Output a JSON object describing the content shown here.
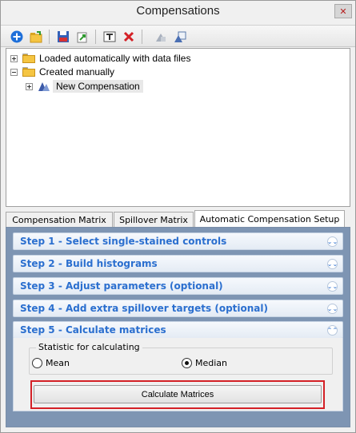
{
  "window": {
    "title": "Compensations",
    "close_glyph": "✕"
  },
  "toolbar": {
    "buttons": [
      {
        "icon": "add-icon"
      },
      {
        "icon": "open-folder-icon"
      },
      {
        "icon": "save-icon"
      },
      {
        "icon": "export-icon"
      },
      {
        "icon": "rename-icon"
      },
      {
        "icon": "delete-icon"
      },
      {
        "icon": "copy-icon"
      },
      {
        "icon": "duplicate-icon"
      }
    ]
  },
  "tree": {
    "items": [
      {
        "label": "Loaded automatically with data files",
        "expander": "+"
      },
      {
        "label": "Created manually",
        "expander": "−"
      },
      {
        "label": "New Compensation",
        "expander": "+"
      }
    ]
  },
  "tabs": [
    {
      "label": "Compensation Matrix"
    },
    {
      "label": "Spillover Matrix"
    },
    {
      "label": "Automatic Compensation Setup"
    }
  ],
  "steps": [
    {
      "label": "Step 1 - Select single-stained controls",
      "chevron": "⌄⌄"
    },
    {
      "label": "Step 2 - Build histograms",
      "chevron": "⌄⌄"
    },
    {
      "label": "Step 3 - Adjust parameters (optional)",
      "chevron": "⌄⌄"
    },
    {
      "label": "Step 4 - Add extra spillover targets (optional)",
      "chevron": "⌄⌄"
    },
    {
      "label": "Step 5 - Calculate matrices",
      "chevron": "⌃⌃"
    }
  ],
  "statistic": {
    "legend": "Statistic for calculating",
    "options": [
      {
        "label": "Mean",
        "selected": false
      },
      {
        "label": "Median",
        "selected": true
      }
    ]
  },
  "calculate_button": "Calculate Matrices",
  "colors": {
    "accent": "#2b6fcf",
    "panel_bg": "#7e95b3",
    "highlight_box": "#d42026"
  }
}
